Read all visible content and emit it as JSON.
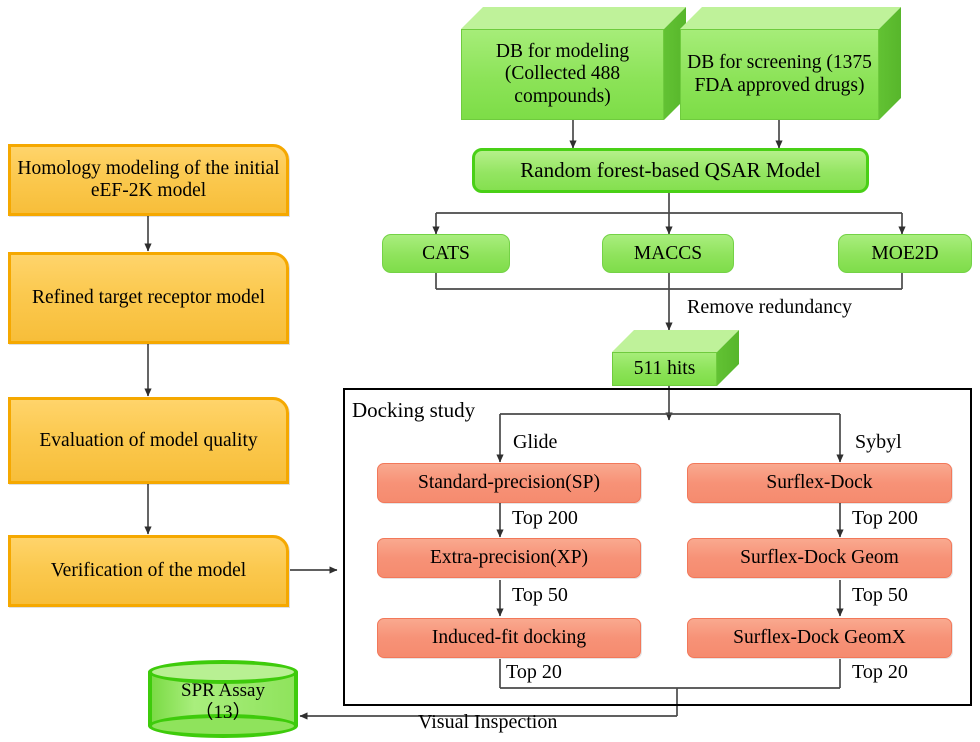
{
  "diagram": {
    "title": "eEF-2K virtual screening workflow",
    "colors": {
      "orange_fill": "#FBC94F",
      "orange_border": "#F5A800",
      "green_fill": "#8FE35C",
      "green_border": "#49D016",
      "salmon_fill": "#F79277",
      "salmon_border": "#F2785A",
      "connector": "#4a4a4a",
      "container_border": "#000000"
    }
  },
  "left_column": {
    "nodes": [
      {
        "id": "homology",
        "label": "Homology modeling of the initial eEF-2K model"
      },
      {
        "id": "refined",
        "label": "Refined target receptor model"
      },
      {
        "id": "evaluation",
        "label": "Evaluation of model quality"
      },
      {
        "id": "verification",
        "label": "Verification of the model"
      }
    ]
  },
  "databases": [
    {
      "id": "db-modeling",
      "label": "DB for modeling (Collected 488 compounds)"
    },
    {
      "id": "db-screening",
      "label": "DB for screening (1375 FDA approved drugs)"
    }
  ],
  "qsar": {
    "label": "Random forest-based QSAR Model"
  },
  "descriptors": [
    {
      "id": "cats",
      "label": "CATS"
    },
    {
      "id": "maccs",
      "label": "MACCS"
    },
    {
      "id": "moe2d",
      "label": "MOE2D"
    }
  ],
  "edge_labels": {
    "remove_redundancy": "Remove redundancy",
    "glide": "Glide",
    "sybyl": "Sybyl",
    "visual_inspection": "Visual Inspection",
    "top200_left": "Top 200",
    "top50_left": "Top 50",
    "top20_left": "Top 20",
    "top200_right": "Top 200",
    "top50_right": "Top 50",
    "top20_right": "Top 20"
  },
  "hits": {
    "label": "511 hits"
  },
  "docking": {
    "title": "Docking study",
    "glide_pipeline": [
      {
        "id": "sp",
        "label": "Standard-precision(SP)"
      },
      {
        "id": "xp",
        "label": "Extra-precision(XP)"
      },
      {
        "id": "ifd",
        "label": "Induced-fit docking"
      }
    ],
    "sybyl_pipeline": [
      {
        "id": "surflex",
        "label": "Surflex-Dock"
      },
      {
        "id": "surflex-geom",
        "label": "Surflex-Dock Geom"
      },
      {
        "id": "surflex-geomx",
        "label": "Surflex-Dock GeomX"
      }
    ]
  },
  "assay": {
    "line1": "SPR Assay",
    "line2": "（13）"
  }
}
